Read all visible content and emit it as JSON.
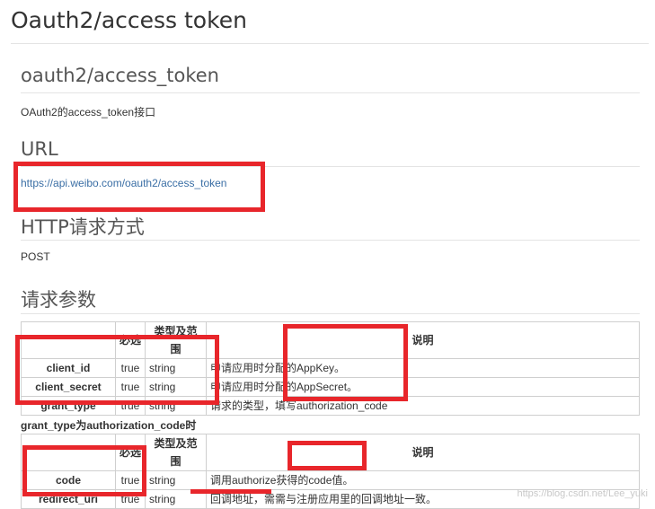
{
  "page_title": "Oauth2/access token",
  "api_name": "oauth2/access_token",
  "description": "OAuth2的access_token接口",
  "url_heading": "URL",
  "url": "https://api.weibo.com/oauth2/access_token",
  "method_heading": "HTTP请求方式",
  "method": "POST",
  "params_heading": "请求参数",
  "table_headers": {
    "name": "",
    "required": "必选",
    "type": "类型及范围",
    "desc": "说明"
  },
  "params": [
    {
      "name": "client_id",
      "required": "true",
      "type": "string",
      "desc": "申请应用时分配的AppKey。"
    },
    {
      "name": "client_secret",
      "required": "true",
      "type": "string",
      "desc": "申请应用时分配的AppSecret。"
    },
    {
      "name": "grant_type",
      "required": "true",
      "type": "string",
      "desc": "请求的类型，填写authorization_code"
    }
  ],
  "subsection_heading": "grant_type为authorization_code时",
  "sub_params": [
    {
      "name": "code",
      "required": "true",
      "type": "string",
      "desc": "调用authorize获得的code值。"
    },
    {
      "name": "redirect_uri",
      "required": "true",
      "type": "string",
      "desc": "回调地址，需需与注册应用里的回调地址一致。"
    }
  ],
  "watermark": "https://blog.csdn.net/Lee_yuki",
  "colors": {
    "annotation_red": "#e8262b",
    "link": "#3a6ea5"
  }
}
